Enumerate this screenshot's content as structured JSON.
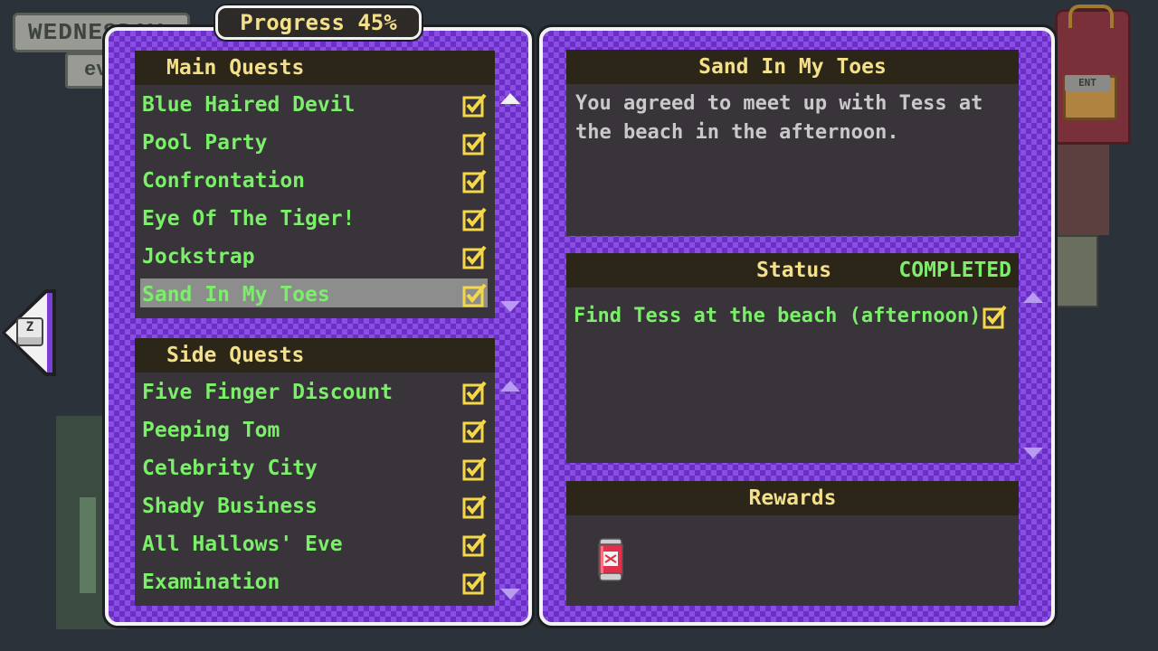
{
  "background": {
    "day_text": "WEDNESDAY",
    "time_text": "ev",
    "backpack_tag": "ENT"
  },
  "nav": {
    "key_hint": "Z"
  },
  "progress": {
    "label": "Progress 45%",
    "value_percent": 45
  },
  "main_quests": {
    "title": "Main Quests",
    "items": [
      {
        "label": "Blue Haired Devil",
        "completed": true
      },
      {
        "label": "Pool Party",
        "completed": true
      },
      {
        "label": "Confrontation",
        "completed": true
      },
      {
        "label": "Eye Of The Tiger!",
        "completed": true
      },
      {
        "label": "Jockstrap",
        "completed": true
      },
      {
        "label": "Sand In My Toes",
        "completed": true,
        "selected": true
      }
    ]
  },
  "side_quests": {
    "title": "Side Quests",
    "items": [
      {
        "label": "Five Finger Discount",
        "completed": true
      },
      {
        "label": "Peeping Tom",
        "completed": true
      },
      {
        "label": "Celebrity City",
        "completed": true
      },
      {
        "label": "Shady Business",
        "completed": true
      },
      {
        "label": "All Hallows' Eve",
        "completed": true
      },
      {
        "label": "Examination",
        "completed": true
      }
    ]
  },
  "detail": {
    "title": "Sand In My Toes",
    "description": "You agreed to meet up with Tess at the beach in the afternoon.",
    "status_label": "Status",
    "status_value": "COMPLETED",
    "objectives": [
      {
        "label": "Find Tess at the beach (afternoon)",
        "completed": true
      }
    ],
    "rewards_title": "Rewards",
    "rewards": [
      {
        "icon": "soda-can-icon"
      }
    ]
  },
  "colors": {
    "panel_purple": "#7b3fd6",
    "quest_green": "#7bee6a",
    "header_yellow": "#f4e08a",
    "check_yellow": "#f4d84a"
  }
}
